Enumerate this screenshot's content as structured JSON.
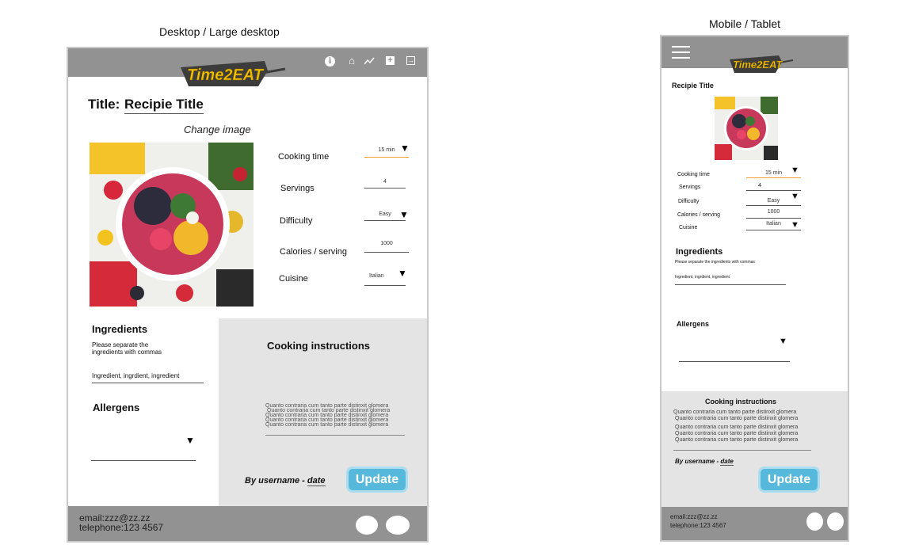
{
  "captions": {
    "desktop": "Desktop / Large desktop",
    "mobile": "Mobile / Tablet"
  },
  "brand": {
    "logo_text": "Time2EAT"
  },
  "desktop": {
    "title_label": "Title:",
    "title_value": "Recipie Title",
    "change_image": "Change image",
    "fields": {
      "cooking_time": {
        "label": "Cooking time",
        "value": "15 min"
      },
      "servings": {
        "label": "Servings",
        "value": "4"
      },
      "difficulty": {
        "label": "Difficulty",
        "value": "Easy"
      },
      "calories": {
        "label": "Calories / serving",
        "value": "1000"
      },
      "cuisine": {
        "label": "Cuisine",
        "value": "Italian"
      }
    },
    "ingredients": {
      "heading": "Ingredients",
      "hint": "Please separate the ingredients with commas",
      "placeholder": "Ingredient, ingrdient, ingredient"
    },
    "allergens": {
      "heading": "Allergens"
    },
    "instructions": {
      "heading": "Cooking instructions",
      "lines": [
        "Quanto contraria cum tanto parte distinxit glomera",
        "Quanto contraria cum tanto parte distinxit glomera",
        "Quanto contraria cum tanto parte distinxit glomera",
        "Quanto contraria cum tanto parte distinxit glomera",
        "Quanto contraria cum tanto parte distinxit glomera"
      ]
    },
    "byline": {
      "prefix": "By username - ",
      "date": "date"
    },
    "update": "Update",
    "footer": {
      "email": "email:zzz@zz.zz",
      "telephone": "telephone:123 4567"
    }
  },
  "mobile": {
    "title": "Recipie Title",
    "fields": {
      "cooking_time": {
        "label": "Cooking time",
        "value": "15 min"
      },
      "servings": {
        "label": "Servings",
        "value": "4"
      },
      "difficulty": {
        "label": "Difficulty",
        "value": "Easy"
      },
      "calories": {
        "label": "Calories / serving",
        "value": "1000"
      },
      "cuisine": {
        "label": "Cuisine",
        "value": "Italian"
      }
    },
    "ingredients": {
      "heading": "Ingredients",
      "hint": "Please separate the ingredients with commas",
      "placeholder": "Ingredient, ingrdient, ingredient"
    },
    "allergens": {
      "heading": "Allergens"
    },
    "instructions": {
      "heading": "Cooking instructions",
      "lines": [
        "Quanto contraria cum tanto parte distinxit glomera",
        "Quanto contraria cum tanto parte distinxit glomera",
        "Quanto contraria cum tanto parte distinxit glomera",
        "Quanto contraria cum tanto parte distinxit glomera",
        "Quanto contraria cum tanto parte distinxit glomera"
      ]
    },
    "byline": {
      "prefix": "By username - ",
      "date": "date"
    },
    "update": "Update",
    "footer": {
      "email": "email:zzz@zz.zz",
      "telephone": "telephone:123 4567"
    }
  },
  "icons": [
    "info-icon",
    "home-icon",
    "trend-icon",
    "add-icon",
    "logout-icon",
    "menu-icon",
    "dropdown-arrow-icon",
    "social-icon"
  ],
  "colors": {
    "header": "#929292",
    "panel": "#e4e4e4",
    "accent": "#56b9dc",
    "logo_yellow": "#f2c200",
    "underline_orange": "#f0a030"
  }
}
